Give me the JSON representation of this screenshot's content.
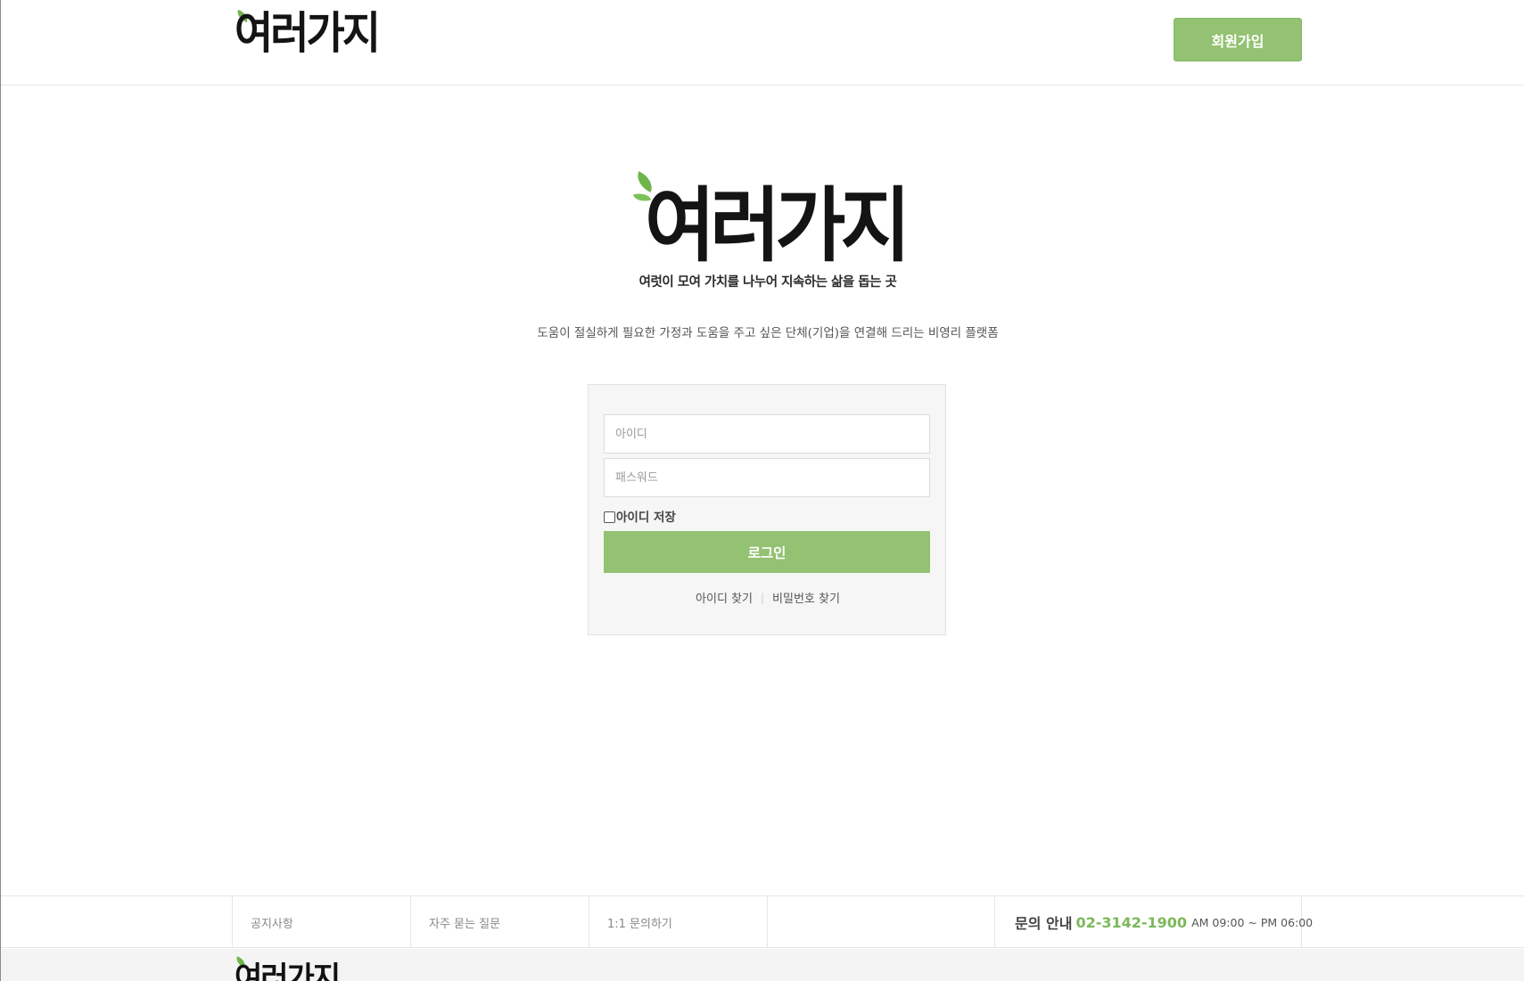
{
  "header": {
    "logo_text": "여러가지",
    "signup_label": "회원가입"
  },
  "hero": {
    "logo_text": "여러가지",
    "slogan": "여럿이 모여 가치를 나누어 지속하는 삶을 돕는 곳",
    "description": "도움이 절실하게 필요한 가정과 도움을 주고 싶은 단체(기업)을 연결해 드리는 비영리 플랫폼"
  },
  "login": {
    "id_placeholder": "아이디",
    "password_placeholder": "패스워드",
    "remember_label": "아이디 저장",
    "remember_checked": false,
    "submit_label": "로그인",
    "find_id_label": "아이디 찾기",
    "separator": "|",
    "find_password_label": "비밀번호 찾기"
  },
  "footer": {
    "links": [
      "공지사항",
      "자주 묻는 질문",
      "1:1 문의하기"
    ],
    "contact_label": "문의 안내",
    "contact_phone": "02-3142-1900",
    "contact_hours": "AM 09:00 ~ PM 06:00",
    "logo_text": "여러가지"
  },
  "colors": {
    "accent_green": "#93c272",
    "phone_green": "#7cb85a",
    "leaf_green": "#6fb54b"
  },
  "icons": {
    "logo_leaf": "leaf-icon",
    "checkbox": "checkbox-icon"
  }
}
